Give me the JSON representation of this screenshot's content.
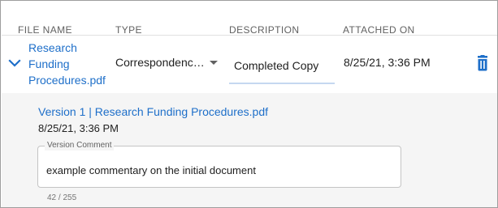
{
  "columns": {
    "file_name": "FILE NAME",
    "type": "TYPE",
    "description": "DESCRIPTION",
    "attached_on": "ATTACHED ON"
  },
  "row": {
    "file_name_line1": "Research",
    "file_name_line2": "Funding",
    "file_name_line3": "Procedures.pdf",
    "type_value": "Correspondence…",
    "description_value": "Completed Copy",
    "attached_on": "8/25/21, 3:36 PM",
    "expand_icon": "chevron-down-icon",
    "delete_icon": "trash-icon"
  },
  "details": {
    "version_link": "Version 1 | Research Funding Procedures.pdf",
    "version_date": "8/25/21, 3:36 PM",
    "comment_label": "Version Comment",
    "comment_text": "example commentary on the initial document",
    "char_counter": "42 / 255"
  },
  "colors": {
    "link": "#1e6fc9",
    "details_bg": "#f5f5f5"
  }
}
